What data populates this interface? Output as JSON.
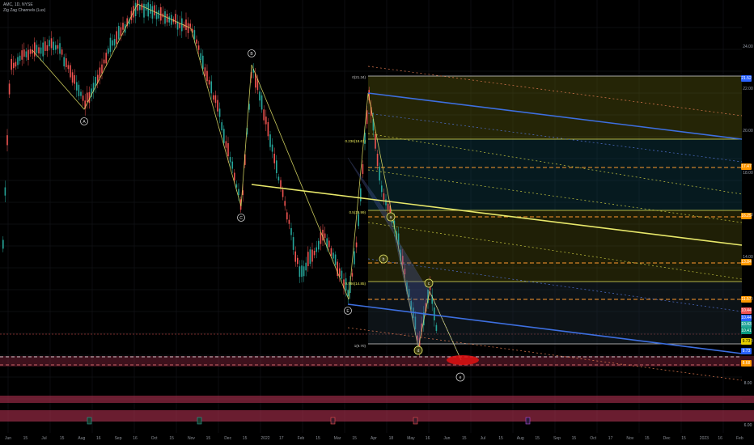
{
  "header": {
    "symbol_line": "AMC, 1D, NYSE",
    "indicator_line": "Zig Zag Channels (Lux)"
  },
  "colors": {
    "background": "#000000",
    "up_candle": "#26a69a",
    "down_candle": "#ef5350",
    "zigzag_line": "#e8e86a",
    "fib_line": "#e8e85a",
    "channel_blue": "#3d6fe0",
    "orange_dash": "#ff9a2e",
    "support_band": "#b03050"
  },
  "wave_labels": [
    {
      "id": "A",
      "text": "A"
    },
    {
      "id": "B",
      "text": "B"
    },
    {
      "id": "C",
      "text": "C"
    },
    {
      "id": "E",
      "text": "E"
    },
    {
      "id": "a",
      "text": "a"
    },
    {
      "id": "b",
      "text": "b"
    },
    {
      "id": "c",
      "text": "c"
    },
    {
      "id": "d",
      "text": "d"
    },
    {
      "id": "e",
      "text": "e"
    }
  ],
  "fib_levels": [
    {
      "id": "fib1",
      "label": "0(21.34)"
    },
    {
      "id": "fib2",
      "label": "0.236(18.61)"
    },
    {
      "id": "fib3",
      "label": "0.5(15.99)"
    },
    {
      "id": "fib4",
      "label": "0.786(14.85)"
    },
    {
      "id": "fib5",
      "label": "1(9.70)"
    }
  ],
  "price_tags": [
    {
      "id": "t1",
      "text": "21.52",
      "color": "#2962ff"
    },
    {
      "id": "t2",
      "text": "17.47",
      "color": "#ff9800"
    },
    {
      "id": "t3",
      "text": "16.29",
      "color": "#ff9800"
    },
    {
      "id": "t4",
      "text": "13.84",
      "color": "#ff9800"
    },
    {
      "id": "t5",
      "text": "11.57",
      "color": "#ff9800"
    },
    {
      "id": "t6",
      "text": "10.44",
      "color": "#ef5350"
    },
    {
      "id": "t7",
      "text": "10.44",
      "color": "#2962ff"
    },
    {
      "id": "t8",
      "text": "10.43",
      "color": "#26a69a"
    },
    {
      "id": "t9",
      "text": "10.41",
      "color": "#089981"
    },
    {
      "id": "t10",
      "text": "9.73",
      "color": "#e8d000"
    },
    {
      "id": "t11",
      "text": "9.73",
      "color": "#2962ff"
    },
    {
      "id": "t12",
      "text": "8.68",
      "color": "#ff9800"
    }
  ],
  "x_axis": [
    "Jun",
    "15",
    "Jul",
    "15",
    "Aug",
    "16",
    "Sep",
    "16",
    "Oct",
    "15",
    "Nov",
    "15",
    "Dec",
    "15",
    "2022",
    "17",
    "Feb",
    "15",
    "Mar",
    "15",
    "Apr",
    "18",
    "May",
    "16",
    "Jun",
    "15",
    "Jul",
    "15",
    "Aug",
    "15",
    "Sep",
    "15",
    "Oct",
    "17",
    "Nov",
    "15",
    "Dec",
    "15",
    "2023",
    "16",
    "Feb"
  ],
  "y_axis": [
    "24.00",
    "22.00",
    "20.00",
    "18.00",
    "16.00",
    "14.00",
    "12.00",
    "10.00",
    "8.00",
    "6.00"
  ]
}
